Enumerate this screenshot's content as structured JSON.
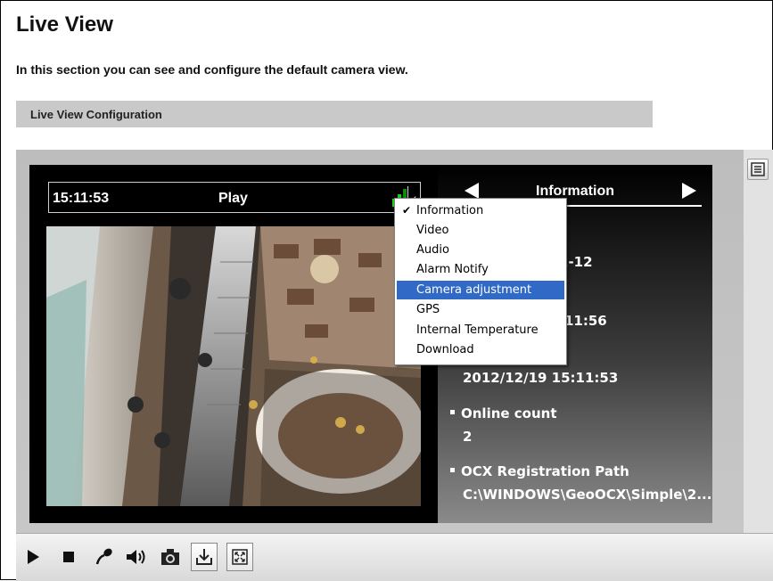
{
  "page": {
    "title": "Live View",
    "description": "In this section you can see and configure the default camera view.",
    "section_label": "Live View Configuration"
  },
  "viewer": {
    "status": {
      "time": "15:11:53",
      "state": "Play"
    },
    "info_panel": {
      "title": "Information",
      "rows": [
        {
          "text": "2-12"
        },
        {
          "text": ":11:56"
        },
        {
          "text": "2012/12/19 15:11:53"
        },
        {
          "label": "Online count",
          "value": "2"
        },
        {
          "label": "OCX Registration Path",
          "value": "C:\\WINDOWS\\GeoOCX\\Simple\\2..."
        }
      ]
    },
    "dropdown": {
      "items": [
        "Information",
        "Video",
        "Audio",
        "Alarm Notify",
        "Camera adjustment",
        "GPS",
        "Internal Temperature",
        "Download"
      ],
      "checked_item": "Information",
      "highlighted_item": "Camera adjustment"
    }
  },
  "toolbar": {
    "buttons": [
      "play-icon",
      "stop-icon",
      "microphone-icon",
      "speaker-icon",
      "snapshot-icon",
      "download-icon",
      "fullscreen-icon"
    ]
  },
  "colors": {
    "signal": "#1ad21a",
    "highlight": "#3169c6",
    "section_bar": "#c9c9c9"
  }
}
